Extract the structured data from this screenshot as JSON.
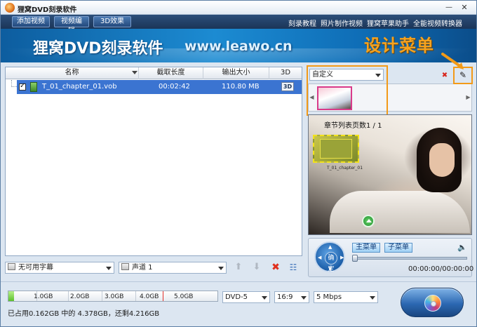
{
  "window": {
    "title": "狸窝DVD刻录软件",
    "minimize": "—",
    "close": "✕"
  },
  "toolbar": {
    "add_video": "添加视频",
    "edit_video": "视频编辑",
    "effect_3d": "3D效果",
    "links": [
      "刻录教程",
      "照片制作视频",
      "狸窝苹果助手",
      "全能视频转换器"
    ]
  },
  "banner": {
    "product": "狸窝DVD刻录软件",
    "url": "www.leawo.cn",
    "callout": "设计菜单"
  },
  "file_list": {
    "columns": [
      "名称",
      "截取长度",
      "输出大小",
      "3D"
    ],
    "rows": [
      {
        "name": "T_01_chapter_01.vob",
        "length": "00:02:42",
        "size": "110.80 MB",
        "checked": true,
        "badge_3d": "3D"
      }
    ]
  },
  "controls": {
    "subtitle": "无可用字幕",
    "audio": "声道 1",
    "move_up": "⬆",
    "move_down": "⬇",
    "delete": "✖",
    "clear": "☷"
  },
  "menu": {
    "template": "自定义",
    "design_icon": "pencil-icon",
    "delete_icon": "delete-menu-icon"
  },
  "preview": {
    "page_label": "章节列表页数1 / 1",
    "chapter_label": "T_01_chapter_01"
  },
  "player": {
    "ok_label": "确定",
    "main_menu": "主菜单",
    "sub_menu": "子菜单",
    "time": "00:00:00/00:00:00",
    "progress": 0
  },
  "bottom": {
    "ticks": [
      "1.0GB",
      "2.0GB",
      "3.0GB",
      "4.0GB",
      "5.0GB"
    ],
    "usage_text": "已占用0.162GB 中的 4.378GB，还剩4.216GB",
    "used_gb": 0.162,
    "disc": "DVD-5",
    "ratio": "16:9",
    "bitrate": "5 Mbps"
  },
  "colors": {
    "accent_orange": "#f29a18",
    "selection_blue": "#3b74d1",
    "banner_blue": "#1c8bd2"
  }
}
